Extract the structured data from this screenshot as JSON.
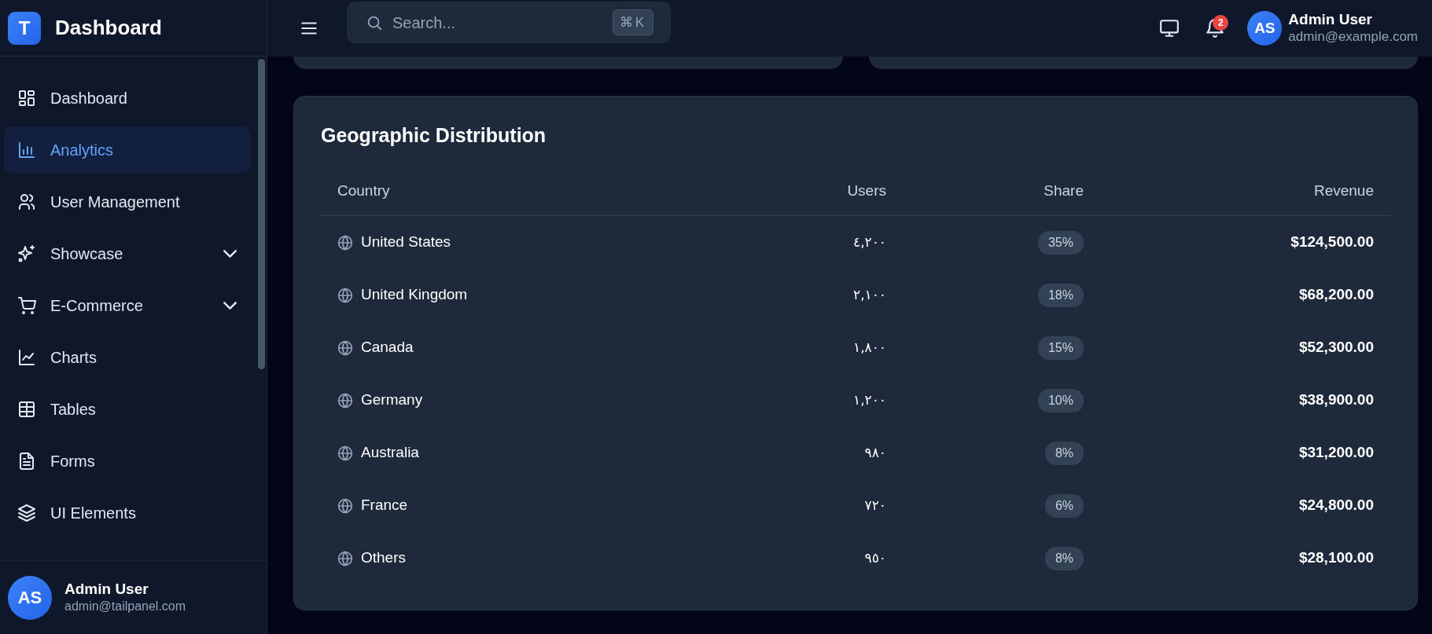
{
  "brand": {
    "logo": "T",
    "title": "Dashboard"
  },
  "sidebar": {
    "items": [
      {
        "label": "Dashboard",
        "kind": "link",
        "selected": false
      },
      {
        "label": "Analytics",
        "kind": "link",
        "selected": true
      },
      {
        "label": "User Management",
        "kind": "link",
        "selected": false
      },
      {
        "label": "Showcase",
        "kind": "group",
        "selected": false
      },
      {
        "label": "E-Commerce",
        "kind": "group",
        "selected": false
      },
      {
        "label": "Charts",
        "kind": "link",
        "selected": false
      },
      {
        "label": "Tables",
        "kind": "link",
        "selected": false
      },
      {
        "label": "Forms",
        "kind": "link",
        "selected": false
      },
      {
        "label": "UI Elements",
        "kind": "link",
        "selected": false
      }
    ],
    "user": {
      "initials": "AS",
      "name": "Admin User",
      "email": "admin@tailpanel.com"
    }
  },
  "header": {
    "search": {
      "placeholder": "Search...",
      "shortcut": "⌘K"
    },
    "notifications": "2",
    "user": {
      "initials": "AS",
      "name": "Admin User",
      "email": "admin@example.com"
    }
  },
  "geographic": {
    "title": "Geographic Distribution",
    "columns": [
      "Country",
      "Users",
      "Share",
      "Revenue"
    ],
    "rows": [
      {
        "country": "United States",
        "users": "٤,٢٠٠",
        "share": "35%",
        "revenue": "$124,500.00"
      },
      {
        "country": "United Kingdom",
        "users": "٢,١٠٠",
        "share": "18%",
        "revenue": "$68,200.00"
      },
      {
        "country": "Canada",
        "users": "١,٨٠٠",
        "share": "15%",
        "revenue": "$52,300.00"
      },
      {
        "country": "Germany",
        "users": "١,٢٠٠",
        "share": "10%",
        "revenue": "$38,900.00"
      },
      {
        "country": "Australia",
        "users": "٩٨٠",
        "share": "8%",
        "revenue": "$31,200.00"
      },
      {
        "country": "France",
        "users": "٧٢٠",
        "share": "6%",
        "revenue": "$24,800.00"
      },
      {
        "country": "Others",
        "users": "٩٥٠",
        "share": "8%",
        "revenue": "$28,100.00"
      }
    ]
  }
}
